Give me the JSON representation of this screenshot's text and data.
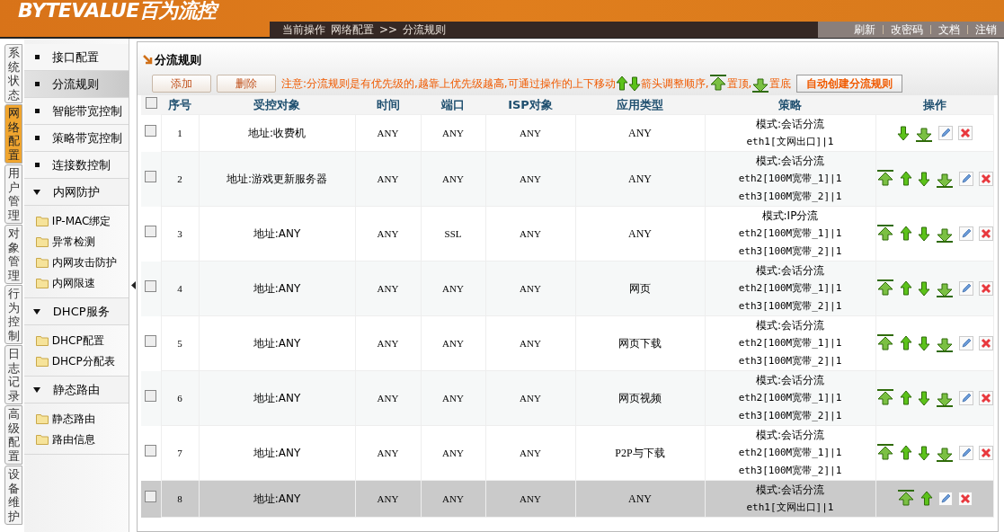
{
  "header": {
    "logo_latin": "BYTEVALUE",
    "logo_cjk": "百为流控",
    "breadcrumb": [
      "当前操作",
      "网络配置",
      ">>",
      "分流规则"
    ],
    "links": [
      "刷新",
      "改密码",
      "文档",
      "注销"
    ]
  },
  "side_tabs": [
    {
      "label": "系统状态",
      "selected": false
    },
    {
      "label": "网络配置",
      "selected": true
    },
    {
      "label": "用户管理",
      "selected": false
    },
    {
      "label": "对象管理",
      "selected": false
    },
    {
      "label": "行为控制",
      "selected": false
    },
    {
      "label": "日志记录",
      "selected": false
    },
    {
      "label": "高级配置",
      "selected": false
    },
    {
      "label": "设备维护",
      "selected": false
    }
  ],
  "menu": [
    {
      "kind": "item",
      "label": "接口配置",
      "selected": false
    },
    {
      "kind": "item",
      "label": "分流规则",
      "selected": true
    },
    {
      "kind": "item",
      "label": "智能带宽控制",
      "selected": false
    },
    {
      "kind": "item",
      "label": "策略带宽控制",
      "selected": false
    },
    {
      "kind": "item",
      "label": "连接数控制",
      "selected": false
    },
    {
      "kind": "group",
      "label": "内网防护",
      "expanded": true,
      "children": [
        {
          "label": "IP-MAC绑定"
        },
        {
          "label": "异常检测"
        },
        {
          "label": "内网攻击防护"
        },
        {
          "label": "内网限速"
        }
      ]
    },
    {
      "kind": "group",
      "label": "DHCP服务",
      "expanded": true,
      "children": [
        {
          "label": "DHCP配置"
        },
        {
          "label": "DHCP分配表"
        }
      ]
    },
    {
      "kind": "group",
      "label": "静态路由",
      "expanded": true,
      "children": [
        {
          "label": "静态路由"
        },
        {
          "label": "路由信息"
        }
      ]
    }
  ],
  "panel": {
    "title": "分流规则",
    "buttons": [
      "添加",
      "删除"
    ],
    "notice": [
      "注意:分流规则是有优先级的,越靠上优先级越高,可通过操作的上下移动",
      "箭头调整顺序,",
      "置顶,",
      "置底"
    ],
    "auto_button": "自动创建分流规则"
  },
  "table": {
    "header_checked": false,
    "columns": [
      "序号",
      "受控对象",
      "时间",
      "端口",
      "ISP对象",
      "应用类型",
      "策略",
      "操作"
    ],
    "rows": [
      {
        "checked": false,
        "selected": false,
        "cells": [
          "1",
          "地址:收费机",
          "ANY",
          "ANY",
          "ANY",
          "ANY"
        ],
        "policy": [
          "模式:会话分流",
          "eth1[文网出口]|1"
        ],
        "actions": [
          {
            "kind": "down"
          },
          {
            "kind": "bottom"
          },
          {
            "kind": "edit"
          },
          {
            "kind": "delete"
          }
        ]
      },
      {
        "checked": false,
        "selected": false,
        "cells": [
          "2",
          "地址:游戏更新服务器",
          "ANY",
          "ANY",
          "ANY",
          "ANY"
        ],
        "policy": [
          "模式:会话分流",
          "eth2[100M宽带_1]|1",
          "eth3[100M宽带_2]|1"
        ],
        "actions": [
          {
            "kind": "top"
          },
          {
            "kind": "up"
          },
          {
            "kind": "down"
          },
          {
            "kind": "bottom"
          },
          {
            "kind": "edit"
          },
          {
            "kind": "delete"
          }
        ]
      },
      {
        "checked": false,
        "selected": false,
        "cells": [
          "3",
          "地址:ANY",
          "ANY",
          "SSL",
          "ANY",
          "ANY"
        ],
        "policy": [
          "模式:IP分流",
          "eth2[100M宽带_1]|1",
          "eth3[100M宽带_2]|1"
        ],
        "actions": [
          {
            "kind": "top"
          },
          {
            "kind": "up"
          },
          {
            "kind": "down"
          },
          {
            "kind": "bottom"
          },
          {
            "kind": "edit"
          },
          {
            "kind": "delete"
          }
        ]
      },
      {
        "checked": false,
        "selected": false,
        "cells": [
          "4",
          "地址:ANY",
          "ANY",
          "ANY",
          "ANY",
          "网页"
        ],
        "policy": [
          "模式:会话分流",
          "eth2[100M宽带_1]|1",
          "eth3[100M宽带_2]|1"
        ],
        "actions": [
          {
            "kind": "top"
          },
          {
            "kind": "up"
          },
          {
            "kind": "down"
          },
          {
            "kind": "bottom"
          },
          {
            "kind": "edit"
          },
          {
            "kind": "delete"
          }
        ]
      },
      {
        "checked": false,
        "selected": false,
        "cells": [
          "5",
          "地址:ANY",
          "ANY",
          "ANY",
          "ANY",
          "网页下载"
        ],
        "policy": [
          "模式:会话分流",
          "eth2[100M宽带_1]|1",
          "eth3[100M宽带_2]|1"
        ],
        "actions": [
          {
            "kind": "top"
          },
          {
            "kind": "up"
          },
          {
            "kind": "down"
          },
          {
            "kind": "bottom"
          },
          {
            "kind": "edit"
          },
          {
            "kind": "delete"
          }
        ]
      },
      {
        "checked": false,
        "selected": false,
        "cells": [
          "6",
          "地址:ANY",
          "ANY",
          "ANY",
          "ANY",
          "网页视频"
        ],
        "policy": [
          "模式:会话分流",
          "eth2[100M宽带_1]|1",
          "eth3[100M宽带_2]|1"
        ],
        "actions": [
          {
            "kind": "top"
          },
          {
            "kind": "up"
          },
          {
            "kind": "down"
          },
          {
            "kind": "bottom"
          },
          {
            "kind": "edit"
          },
          {
            "kind": "delete"
          }
        ]
      },
      {
        "checked": false,
        "selected": false,
        "cells": [
          "7",
          "地址:ANY",
          "ANY",
          "ANY",
          "ANY",
          "P2P与下载"
        ],
        "policy": [
          "模式:会话分流",
          "eth2[100M宽带_1]|1",
          "eth3[100M宽带_2]|1"
        ],
        "actions": [
          {
            "kind": "top"
          },
          {
            "kind": "up"
          },
          {
            "kind": "down"
          },
          {
            "kind": "bottom"
          },
          {
            "kind": "edit"
          },
          {
            "kind": "delete"
          }
        ]
      },
      {
        "checked": false,
        "selected": true,
        "cells": [
          "8",
          "地址:ANY",
          "ANY",
          "ANY",
          "ANY",
          "ANY"
        ],
        "policy": [
          "模式:会话分流",
          "eth1[文网出口]|1"
        ],
        "actions": [
          {
            "kind": "top"
          },
          {
            "kind": "up"
          },
          {
            "kind": "edit"
          },
          {
            "kind": "delete"
          }
        ]
      }
    ]
  }
}
